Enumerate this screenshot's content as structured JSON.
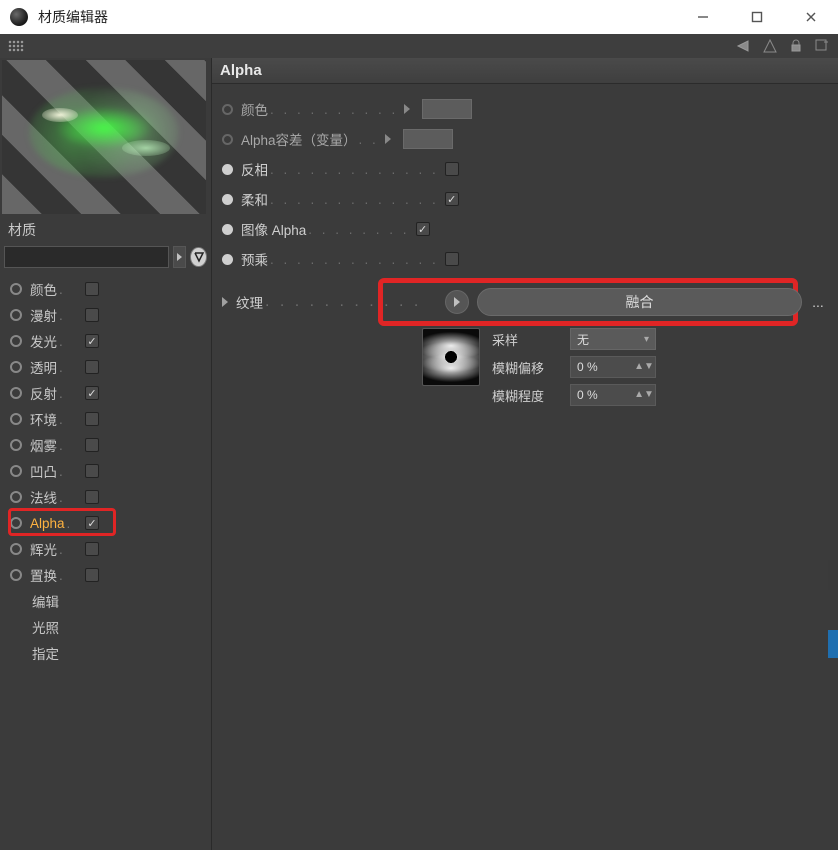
{
  "window": {
    "title": "材质编辑器"
  },
  "sidebar": {
    "material_label": "材质",
    "name_value": "",
    "channels": [
      {
        "label": "颜色",
        "checked": false
      },
      {
        "label": "漫射",
        "checked": false
      },
      {
        "label": "发光",
        "checked": true
      },
      {
        "label": "透明",
        "checked": false
      },
      {
        "label": "反射",
        "checked": true
      },
      {
        "label": "环境",
        "checked": false
      },
      {
        "label": "烟雾",
        "checked": false
      },
      {
        "label": "凹凸",
        "checked": false
      },
      {
        "label": "法线",
        "checked": false
      },
      {
        "label": "Alpha",
        "checked": true,
        "active": true
      },
      {
        "label": "辉光",
        "checked": false
      },
      {
        "label": "置换",
        "checked": false
      }
    ],
    "sub_items": [
      "编辑",
      "光照",
      "指定"
    ],
    "selected_sub": "编辑"
  },
  "panel": {
    "title": "Alpha",
    "props": {
      "color_label": "颜色",
      "alpha_tol_label": "Alpha容差（变量）",
      "invert_label": "反相",
      "soft_label": "柔和",
      "image_alpha_label": "图像 Alpha",
      "premult_label": "预乘",
      "texture_label": "纹理",
      "invert_checked": false,
      "soft_checked": true,
      "image_alpha_checked": true,
      "premult_checked": false,
      "texture_value": "融合",
      "sampling_label": "采样",
      "sampling_value": "无",
      "blur_offset_label": "模糊偏移",
      "blur_offset_value": "0 %",
      "blur_scale_label": "模糊程度",
      "blur_scale_value": "0 %"
    }
  }
}
